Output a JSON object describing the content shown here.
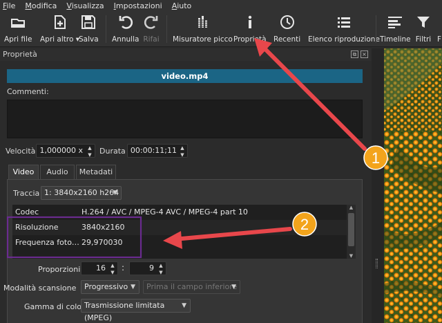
{
  "menubar": {
    "items": [
      {
        "label": "File",
        "mnemonic": "F",
        "rest": "ile"
      },
      {
        "label": "Modifica",
        "mnemonic": "M",
        "rest": "odifica"
      },
      {
        "label": "Visualizza",
        "mnemonic": "V",
        "rest": "isualizza"
      },
      {
        "label": "Impostazioni",
        "mnemonic": "I",
        "rest": "mpostazioni"
      },
      {
        "label": "Aiuto",
        "mnemonic": "A",
        "rest": "iuto"
      }
    ]
  },
  "toolbar": {
    "open_file": "Apri file",
    "open_other": "Apri altro",
    "save": "Salva",
    "undo": "Annulla",
    "redo": "Rifai",
    "peak_meter": "Misuratore picco",
    "properties": "Proprietà",
    "recent": "Recenti",
    "playlist": "Elenco riproduzione",
    "timeline": "Timeline",
    "filters": "Filtri",
    "cut_off": "F"
  },
  "panel": {
    "title": "Proprietà",
    "filename": "video.mp4",
    "comments_label": "Commenti:",
    "speed_label": "Velocità",
    "speed_value": "1,000000 x",
    "duration_label": "Durata",
    "duration_value": "00:00:11;11",
    "tabs": [
      "Video",
      "Audio",
      "Metadati"
    ],
    "track_label": "Traccia",
    "track_value": "1: 3840x2160 h264",
    "table": [
      {
        "key": "Codec",
        "value": "H.264 / AVC / MPEG-4 AVC / MPEG-4 part 10"
      },
      {
        "key": "Risoluzione",
        "value": "3840x2160"
      },
      {
        "key": "Frequenza foto…",
        "value": "29,970030"
      }
    ],
    "aspect_label": "Proporzioni",
    "aspect_num": "16",
    "aspect_den": "9",
    "scan_label": "Modalità scansione",
    "scan_value": "Progressivo",
    "field_order_value": "Prima il campo inferiore",
    "color_range_label": "Gamma di colori",
    "color_range_value": "Trasmissione limitata (MPEG)"
  },
  "annotations": {
    "badge1": "1",
    "badge2": "2",
    "arrow_color": "#e8474b",
    "badge_color": "#f3a41c",
    "highlight_color": "#6a2b8f"
  },
  "colors": {
    "accent": "#1b6585",
    "background": "#2b2b2b"
  }
}
